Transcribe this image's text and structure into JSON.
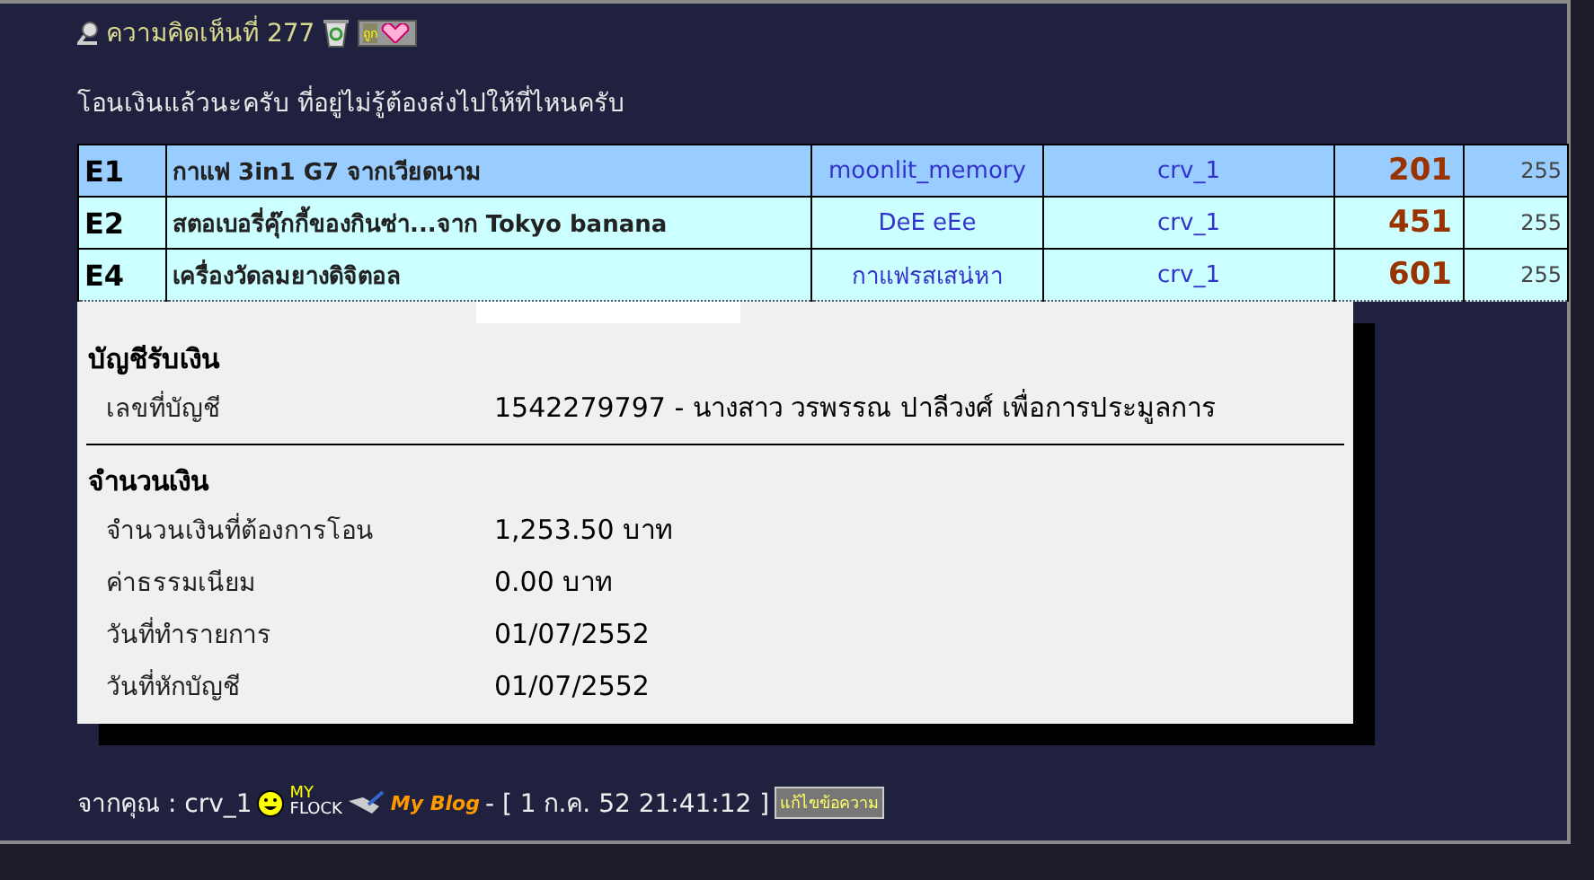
{
  "post": {
    "title": "ความคิดเห็นที่ 277",
    "badge": "ถูก",
    "message": "โอนเงินแล้วนะครับ ที่อยู่ไม่รู้ต้องส่งไปให้ที่ไหนครับ"
  },
  "table": {
    "rows": [
      {
        "cells": [
          "E1",
          "กาแฟ 3in1  G7 จากเวียดนาม",
          "moonlit_memory",
          "crv_1",
          "201",
          "255"
        ],
        "highlighted": true
      },
      {
        "cells": [
          "E2",
          "สตอเบอรี่คุ๊กกี้ของกินซ่า...จาก Tokyo banana",
          "DeE eEe",
          "crv_1",
          "451",
          "255"
        ],
        "highlighted": false
      },
      {
        "cells": [
          "E4",
          "เครื่องวัดลมยางดิจิตอล",
          "กาแฟรสเสน่หา",
          "crv_1",
          "601",
          "255"
        ],
        "highlighted": false
      }
    ]
  },
  "transfer": {
    "sections": [
      {
        "heading": "บัญชีรับเงิน",
        "fields": [
          {
            "label": "เลขที่บัญชี",
            "value": "1542279797 - นางสาว วรพรรณ ปาลีวงศ์ เพื่อการประมูลการ"
          }
        ]
      },
      {
        "heading": "จำนวนเงิน",
        "fields": [
          {
            "label": "จำนวนเงินที่ต้องการโอน",
            "value": "1,253.50 บาท"
          },
          {
            "label": "ค่าธรรมเนียม",
            "value": "0.00 บาท"
          },
          {
            "label": "วันที่ทำรายการ",
            "value": "01/07/2552"
          },
          {
            "label": "วันที่หักบัญชี",
            "value": "01/07/2552"
          }
        ]
      }
    ]
  },
  "footer": {
    "from": "จากคุณ : crv_1",
    "flock_top": "MY",
    "flock_bottom": "FLOCK",
    "blog": "My Blog",
    "timestamp": "- [ 1 ก.ค. 52 21:41:12 ]",
    "edit_button": "แก้ไขข้อความ"
  }
}
